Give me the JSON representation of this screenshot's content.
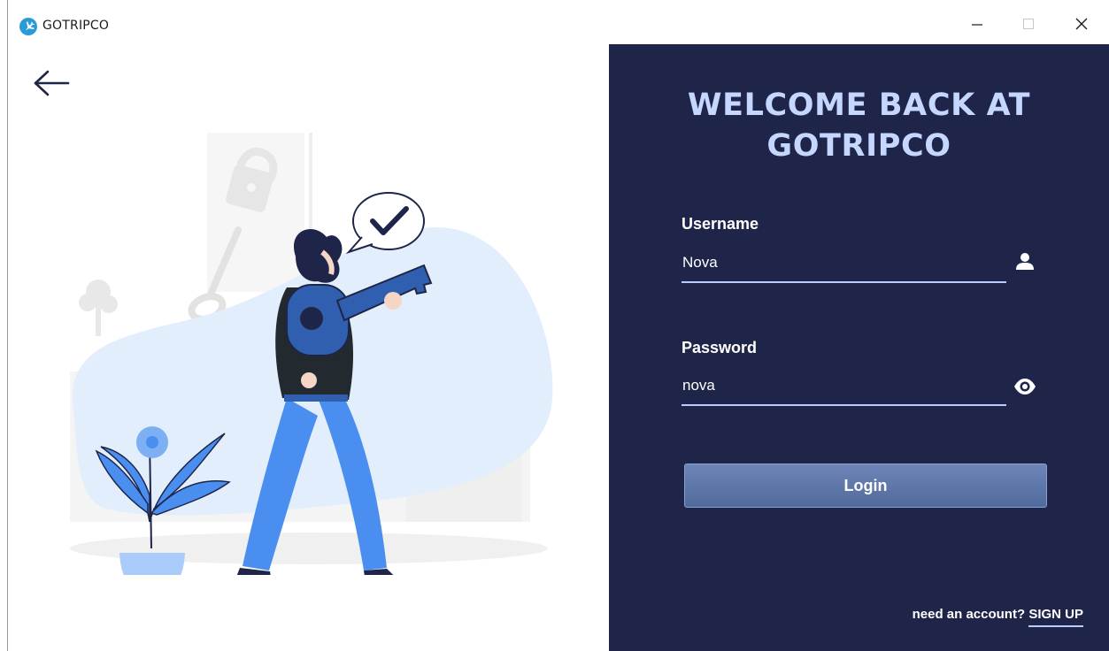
{
  "window": {
    "title": "GOTRIPCO",
    "icon": "airplane-icon",
    "controls": [
      "minimize-icon",
      "maximize-icon",
      "close-icon"
    ]
  },
  "left_panel": {
    "back_icon": "arrow-left-icon",
    "illustration": "person-holding-key-illustration"
  },
  "login_panel": {
    "heading_line1": "WELCOME BACK AT",
    "heading_line2": "GOTRIPCO",
    "username": {
      "label": "Username",
      "value": "Nova",
      "icon": "user-icon"
    },
    "password": {
      "label": "Password",
      "value": "nova",
      "icon": "eye-icon"
    },
    "login_button": "Login",
    "signup_prompt": "need an account?",
    "signup_link": "SIGN UP"
  },
  "colors": {
    "panel_bg": "#1f2548",
    "heading": "#c5d6ff",
    "accent_line": "#b9ccff",
    "button": "#5f78aa",
    "illustration_blue": "#4a8ff0"
  }
}
